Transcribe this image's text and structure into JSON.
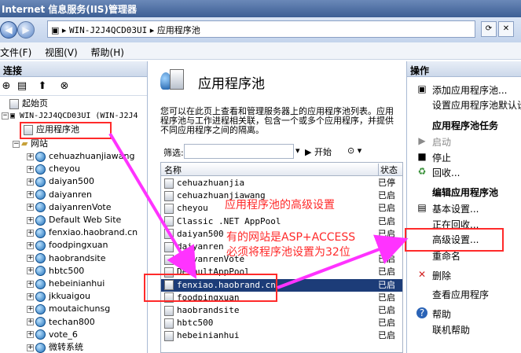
{
  "window": {
    "title": "Internet 信息服务(IIS)管理器"
  },
  "address": {
    "path": [
      "WIN-J2J4QCD03UI",
      "应用程序池"
    ]
  },
  "menu": [
    "文件(F)",
    "视图(V)",
    "帮助(H)"
  ],
  "left_pane": {
    "header": "连接",
    "tree": {
      "start_page": "起始页",
      "server": "WIN-J2J4QCD03UI (WIN-J2J4",
      "app_pools": "应用程序池",
      "sites_label": "网站",
      "sites": [
        "cehuazhuanjiawang",
        "cheyou",
        "daiyan500",
        "daiyanren",
        "daiyanrenVote",
        "Default Web Site",
        "fenxiao.haobrand.cn",
        "foodpingxuan",
        "haobrandsite",
        "hbtc500",
        "hebeinianhui",
        "jkkuaigou",
        "moutaichunsg",
        "techan800",
        "vote_6",
        "微转系统"
      ]
    }
  },
  "center": {
    "title": "应用程序池",
    "description": "您可以在此页上查看和管理服务器上的应用程序池列表。应用程序池与工作进程相关联，包含一个或多个应用程序，并提供不同应用程序之间的隔离。",
    "filter_label": "筛选:",
    "start_label": "开始",
    "columns": [
      "名称",
      "状态"
    ],
    "rows": [
      {
        "name": "cehuazhuanjia",
        "status": "已停"
      },
      {
        "name": "cehuazhuanjiawang",
        "status": "已启"
      },
      {
        "name": "cheyou",
        "status": "已启"
      },
      {
        "name": "Classic .NET AppPool",
        "status": "已启"
      },
      {
        "name": "daiyan500",
        "status": "已启"
      },
      {
        "name": "daiyanren",
        "status": "已启"
      },
      {
        "name": "daiyanrenVote",
        "status": "已启"
      },
      {
        "name": "DefaultAppPool",
        "status": "已启"
      },
      {
        "name": "fenxiao.haobrand.cn",
        "status": "已启"
      },
      {
        "name": "foodpingxuan",
        "status": "已启"
      },
      {
        "name": "haobrandsite",
        "status": "已启"
      },
      {
        "name": "hbtc500",
        "status": "已启"
      },
      {
        "name": "hebeinianhui",
        "status": "已启"
      }
    ]
  },
  "right_pane": {
    "header": "操作",
    "add_pool": "添加应用程序池...",
    "set_defaults": "设置应用程序池默认设置",
    "tasks_header": "应用程序池任务",
    "start": "启动",
    "stop": "停止",
    "recycle": "回收...",
    "edit_header": "编辑应用程序池",
    "basic_settings": "基本设置...",
    "recycling": "正在回收...",
    "advanced_settings": "高级设置...",
    "rename": "重命名",
    "delete": "删除",
    "view_apps": "查看应用程序",
    "help": "帮助",
    "online_help": "联机帮助"
  },
  "annotations": {
    "line1": "应用程序池的高级设置",
    "line2": "有的网站是ASP+ACCESS",
    "line3": "必须将程序池设置为32位"
  },
  "colors": {
    "annotation": "#ff2a2a",
    "arrow": "#ff33ff",
    "selection": "#1c3c78"
  }
}
